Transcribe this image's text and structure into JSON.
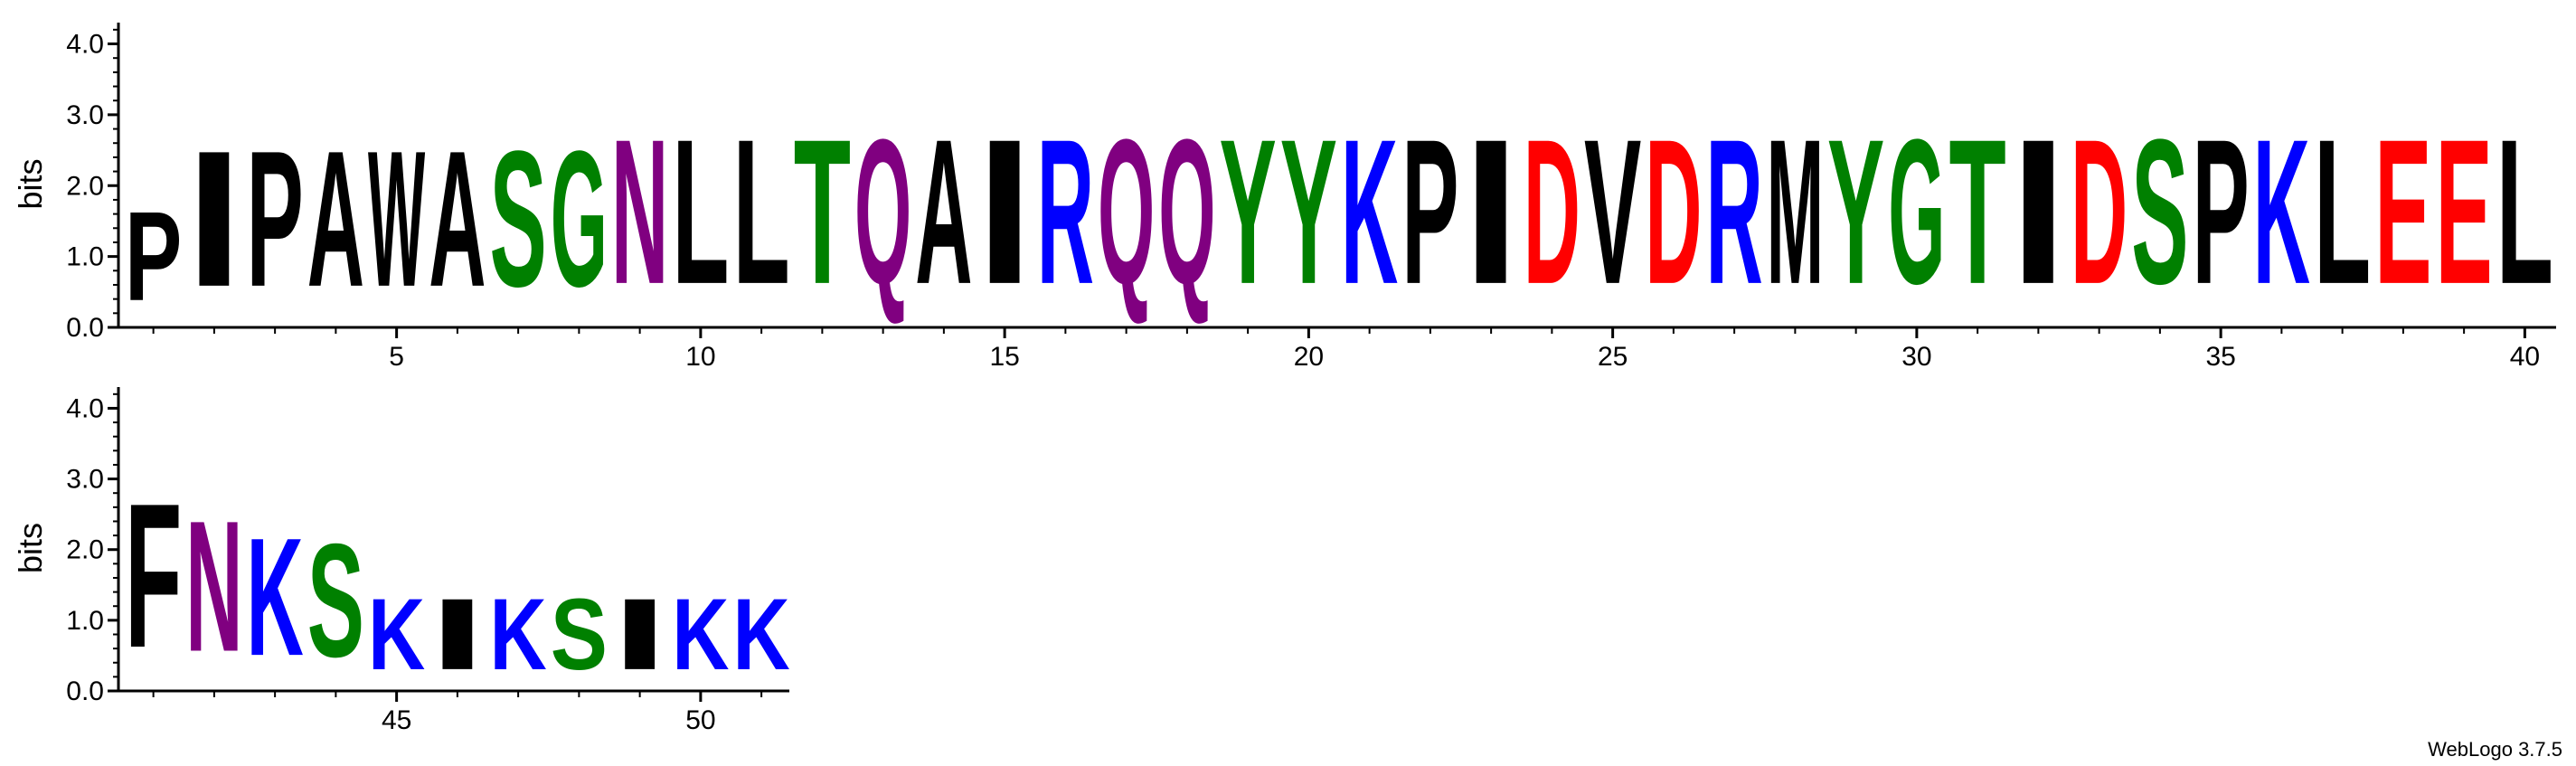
{
  "chart_data": {
    "type": "sequence-logo",
    "credit": "WebLogo 3.7.5",
    "color_scheme": {
      "black": "#000000",
      "green": "#008000",
      "purple": "#800080",
      "blue": "#0000ff",
      "red": "#ff0000"
    },
    "panels": [
      {
        "ylabel": "bits",
        "ylim": [
          0,
          4.3
        ],
        "yticks": [
          "0.0",
          "1.0",
          "2.0",
          "3.0",
          "4.0"
        ],
        "xrange": [
          1,
          40
        ],
        "xticks": [
          "5",
          "10",
          "15",
          "20",
          "25",
          "30",
          "35",
          "40"
        ],
        "positions": [
          {
            "pos": 1,
            "letter": "P",
            "bits": 2.0,
            "color": "#000000"
          },
          {
            "pos": 2,
            "letter": "I",
            "bits": 3.05,
            "color": "#000000"
          },
          {
            "pos": 3,
            "letter": "P",
            "bits": 3.05,
            "color": "#000000"
          },
          {
            "pos": 4,
            "letter": "A",
            "bits": 3.05,
            "color": "#000000"
          },
          {
            "pos": 5,
            "letter": "W",
            "bits": 3.05,
            "color": "#000000"
          },
          {
            "pos": 6,
            "letter": "A",
            "bits": 3.05,
            "color": "#000000"
          },
          {
            "pos": 7,
            "letter": "S",
            "bits": 3.05,
            "color": "#008000"
          },
          {
            "pos": 8,
            "letter": "G",
            "bits": 3.05,
            "color": "#008000"
          },
          {
            "pos": 9,
            "letter": "N",
            "bits": 3.25,
            "color": "#800080"
          },
          {
            "pos": 10,
            "letter": "L",
            "bits": 3.25,
            "color": "#000000"
          },
          {
            "pos": 11,
            "letter": "L",
            "bits": 3.25,
            "color": "#000000"
          },
          {
            "pos": 12,
            "letter": "T",
            "bits": 3.25,
            "color": "#008000"
          },
          {
            "pos": 13,
            "letter": "Q",
            "bits": 3.25,
            "color": "#800080"
          },
          {
            "pos": 14,
            "letter": "A",
            "bits": 3.25,
            "color": "#000000"
          },
          {
            "pos": 15,
            "letter": "I",
            "bits": 3.25,
            "color": "#000000"
          },
          {
            "pos": 16,
            "letter": "R",
            "bits": 3.25,
            "color": "#0000ff"
          },
          {
            "pos": 17,
            "letter": "Q",
            "bits": 3.25,
            "color": "#800080"
          },
          {
            "pos": 18,
            "letter": "Q",
            "bits": 3.25,
            "color": "#800080"
          },
          {
            "pos": 19,
            "letter": "Y",
            "bits": 3.25,
            "color": "#008000"
          },
          {
            "pos": 20,
            "letter": "Y",
            "bits": 3.25,
            "color": "#008000"
          },
          {
            "pos": 21,
            "letter": "K",
            "bits": 3.25,
            "color": "#0000ff"
          },
          {
            "pos": 22,
            "letter": "P",
            "bits": 3.25,
            "color": "#000000"
          },
          {
            "pos": 23,
            "letter": "I",
            "bits": 3.25,
            "color": "#000000"
          },
          {
            "pos": 24,
            "letter": "D",
            "bits": 3.25,
            "color": "#ff0000"
          },
          {
            "pos": 25,
            "letter": "V",
            "bits": 3.25,
            "color": "#000000"
          },
          {
            "pos": 26,
            "letter": "D",
            "bits": 3.25,
            "color": "#ff0000"
          },
          {
            "pos": 27,
            "letter": "R",
            "bits": 3.25,
            "color": "#0000ff"
          },
          {
            "pos": 28,
            "letter": "M",
            "bits": 3.25,
            "color": "#000000"
          },
          {
            "pos": 29,
            "letter": "Y",
            "bits": 3.25,
            "color": "#008000"
          },
          {
            "pos": 30,
            "letter": "G",
            "bits": 3.25,
            "color": "#008000"
          },
          {
            "pos": 31,
            "letter": "T",
            "bits": 3.25,
            "color": "#008000"
          },
          {
            "pos": 32,
            "letter": "I",
            "bits": 3.25,
            "color": "#000000"
          },
          {
            "pos": 33,
            "letter": "D",
            "bits": 3.25,
            "color": "#ff0000"
          },
          {
            "pos": 34,
            "letter": "S",
            "bits": 3.25,
            "color": "#008000"
          },
          {
            "pos": 35,
            "letter": "P",
            "bits": 3.25,
            "color": "#000000"
          },
          {
            "pos": 36,
            "letter": "K",
            "bits": 3.25,
            "color": "#0000ff"
          },
          {
            "pos": 37,
            "letter": "L",
            "bits": 3.25,
            "color": "#000000"
          },
          {
            "pos": 38,
            "letter": "E",
            "bits": 3.25,
            "color": "#ff0000"
          },
          {
            "pos": 39,
            "letter": "E",
            "bits": 3.25,
            "color": "#ff0000"
          },
          {
            "pos": 40,
            "letter": "L",
            "bits": 3.25,
            "color": "#000000"
          }
        ]
      },
      {
        "ylabel": "bits",
        "ylim": [
          0,
          4.3
        ],
        "yticks": [
          "0.0",
          "1.0",
          "2.0",
          "3.0",
          "4.0"
        ],
        "xrange": [
          41,
          51
        ],
        "xticks": [
          "45",
          "50"
        ],
        "positions": [
          {
            "pos": 41,
            "letter": "F",
            "bits": 3.25,
            "color": "#000000"
          },
          {
            "pos": 42,
            "letter": "N",
            "bits": 2.95,
            "color": "#800080"
          },
          {
            "pos": 43,
            "letter": "K",
            "bits": 2.65,
            "color": "#0000ff"
          },
          {
            "pos": 44,
            "letter": "S",
            "bits": 2.55,
            "color": "#008000"
          },
          {
            "pos": 45,
            "letter": "K",
            "bits": 1.6,
            "color": "#0000ff"
          },
          {
            "pos": 46,
            "letter": "I",
            "bits": 1.6,
            "color": "#000000"
          },
          {
            "pos": 47,
            "letter": "K",
            "bits": 1.6,
            "color": "#0000ff"
          },
          {
            "pos": 48,
            "letter": "S",
            "bits": 1.6,
            "color": "#008000"
          },
          {
            "pos": 49,
            "letter": "I",
            "bits": 1.6,
            "color": "#000000"
          },
          {
            "pos": 50,
            "letter": "K",
            "bits": 1.6,
            "color": "#0000ff"
          },
          {
            "pos": 51,
            "letter": "K",
            "bits": 1.6,
            "color": "#0000ff"
          }
        ]
      }
    ]
  }
}
